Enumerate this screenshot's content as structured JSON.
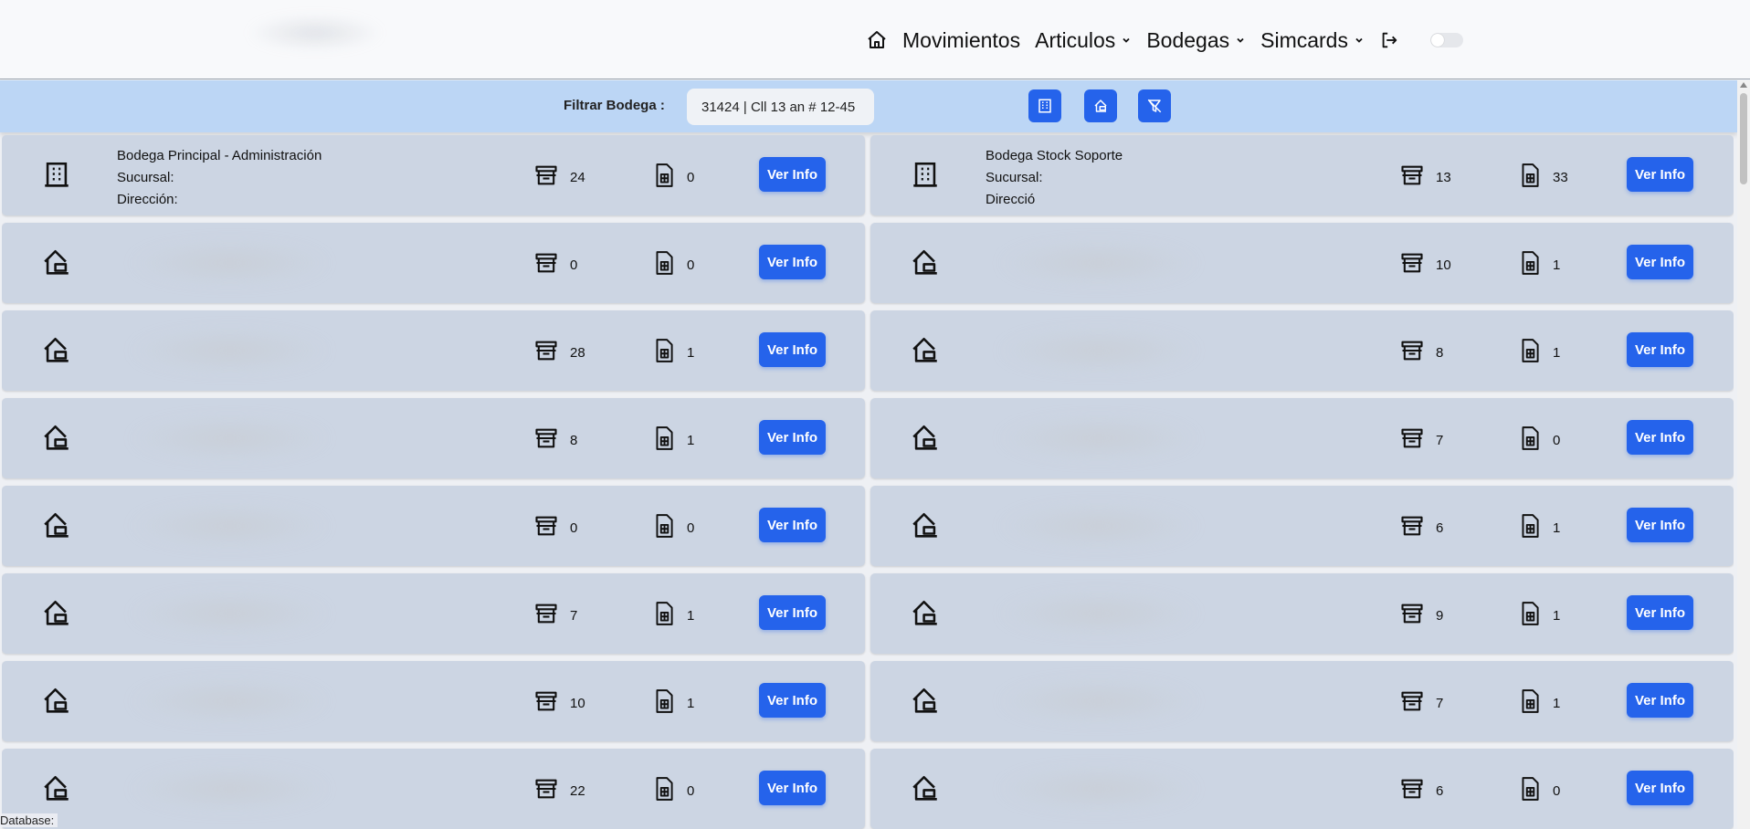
{
  "nav": {
    "home_icon": "home-icon",
    "items": [
      {
        "label": "Movimientos",
        "dropdown": false
      },
      {
        "label": "Articulos",
        "dropdown": true
      },
      {
        "label": "Bodegas",
        "dropdown": true
      },
      {
        "label": "Simcards",
        "dropdown": true
      }
    ],
    "logout_icon": "logout-icon"
  },
  "filter": {
    "label": "Filtrar Bodega :",
    "value": "31424 | Cll 13 an # 12-45"
  },
  "colors": {
    "accent": "#2563eb",
    "filter_bar": "#bcd6f5",
    "card": "#ccd5e3"
  },
  "button_label": "Ver Info",
  "cards_left": [
    {
      "type": "building",
      "name": "Bodega Principal - Administración",
      "sucursal": "Sucursal:",
      "direccion": "Dirección:",
      "items": "24",
      "sims": "0"
    },
    {
      "type": "home",
      "items": "0",
      "sims": "0"
    },
    {
      "type": "home",
      "items": "28",
      "sims": "1"
    },
    {
      "type": "home",
      "items": "8",
      "sims": "1"
    },
    {
      "type": "home",
      "items": "0",
      "sims": "0"
    },
    {
      "type": "home",
      "items": "7",
      "sims": "1"
    },
    {
      "type": "home",
      "items": "10",
      "sims": "1"
    },
    {
      "type": "home",
      "items": "22",
      "sims": "0"
    }
  ],
  "cards_right": [
    {
      "type": "building",
      "name": "Bodega Stock Soporte",
      "sucursal": "Sucursal:",
      "direccion": "Direcció",
      "items": "13",
      "sims": "33"
    },
    {
      "type": "home",
      "items": "10",
      "sims": "1"
    },
    {
      "type": "home",
      "items": "8",
      "sims": "1"
    },
    {
      "type": "home",
      "items": "7",
      "sims": "0"
    },
    {
      "type": "home",
      "items": "6",
      "sims": "1"
    },
    {
      "type": "home",
      "items": "9",
      "sims": "1"
    },
    {
      "type": "home",
      "items": "7",
      "sims": "1"
    },
    {
      "type": "home",
      "items": "6",
      "sims": "0"
    }
  ],
  "footer": {
    "database_label": "Database:"
  }
}
